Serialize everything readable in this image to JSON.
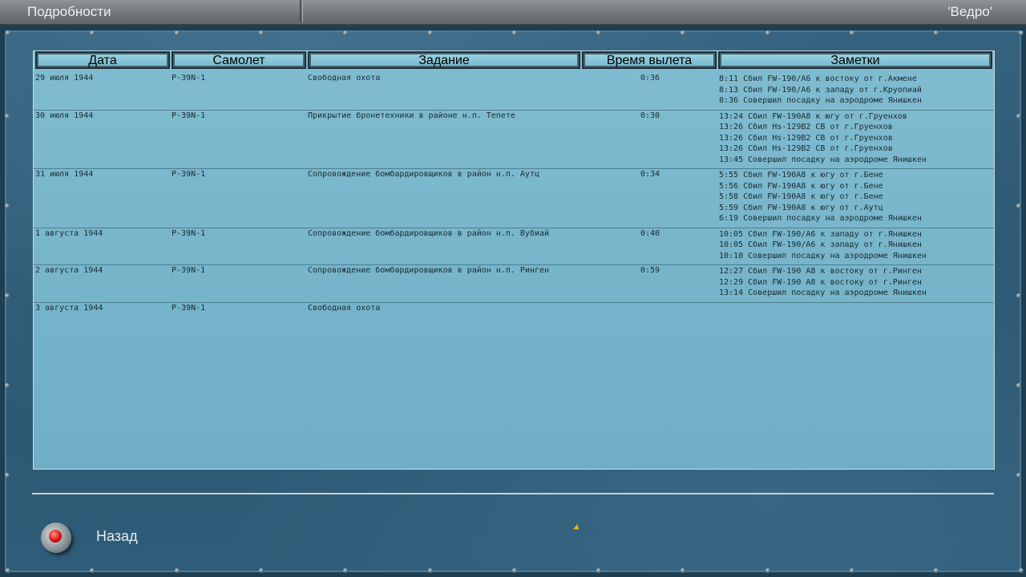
{
  "window": {
    "title": "Подробности",
    "pilot": "'Ведро'"
  },
  "table": {
    "columns": [
      "Дата",
      "Самолет",
      "Задание",
      "Время вылета",
      "Заметки"
    ],
    "rows": [
      {
        "date": "29 июля 1944",
        "plane": "P-39N-1",
        "mission": "Свободная охота",
        "time": "0:36",
        "notes": [
          "8:11 Сбил FW-190/A6 к востоку от г.Акмене",
          "8:13 Сбил FW-190/A6 к западу от г.Круопиай",
          "8:36 Совершил посадку на аэродроме Янишкен"
        ]
      },
      {
        "date": "30 июля 1944",
        "plane": "P-39N-1",
        "mission": "Прикрытие бронетехники в районе н.п. Тепете",
        "time": "0:30",
        "notes": [
          "13:24 Сбил FW-190A8 к югу от г.Груенхов",
          "13:26 Сбил Hs-129B2 СВ от г.Груенхов",
          "13:26 Сбил Hs-129B2 СВ от г.Груенхов",
          "13:26 Сбил Hs-129B2 СВ от г.Груенхов",
          "13:45 Совершил посадку на аэродроме Янишкен"
        ]
      },
      {
        "date": "31 июля 1944",
        "plane": "P-39N-1",
        "mission": "Сопровождение бомбардировщиков в район н.п. Аутц",
        "time": "0:34",
        "notes": [
          "5:55 Сбил FW-190A8 к югу от г.Бене",
          "5:56 Сбил FW-190A8 к югу от г.Бене",
          "5:58 Сбил FW-190A8 к югу от г.Бене",
          "5:59 Сбил FW-190A8 к югу от г.Аутц",
          "6:19 Совершил посадку на аэродроме Янишкен"
        ]
      },
      {
        "date": "1 августа 1944",
        "plane": "P-39N-1",
        "mission": "Сопровождение бомбардировщиков в район н.п. Вубиай",
        "time": "0:40",
        "notes": [
          "10:05 Сбил FW-190/A6 к западу от г.Янишкен",
          "10:05 Сбил FW-190/A6 к западу от г.Янишкен",
          "10:10 Совершил посадку на аэродроме Янишкен"
        ]
      },
      {
        "date": "2 августа 1944",
        "plane": "P-39N-1",
        "mission": "Сопровождение бомбардировщиков в район н.п. Ринген",
        "time": "0:59",
        "notes": [
          "12:27 Сбил FW-190 A8 к востоку от г.Ринген",
          "12:29 Сбил FW-190 A8 к востоку от г.Ринген",
          "13:14 Совершил посадку на аэродроме Янишкен"
        ]
      },
      {
        "date": "3 августа 1944",
        "plane": "P-39N-1",
        "mission": "Свободная охота",
        "time": "",
        "notes": []
      }
    ]
  },
  "footer": {
    "back_label": "Назад"
  }
}
